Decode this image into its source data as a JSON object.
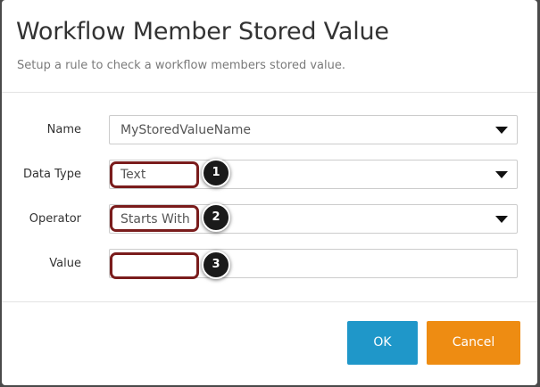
{
  "dialog": {
    "title": "Workflow Member Stored Value",
    "subtitle": "Setup a rule to check a workflow members stored value."
  },
  "form": {
    "name": {
      "label": "Name",
      "value": "MyStoredValueName"
    },
    "data_type": {
      "label": "Data Type",
      "value": "Text"
    },
    "operator": {
      "label": "Operator",
      "value": "Starts With"
    },
    "value": {
      "label": "Value",
      "value": ""
    }
  },
  "callouts": [
    "1",
    "2",
    "3"
  ],
  "buttons": {
    "ok": "OK",
    "cancel": "Cancel"
  },
  "colors": {
    "ok_button": "#1f97c9",
    "cancel_button": "#ee8c12",
    "callout_border": "#7a1c1c",
    "marker": "#1a1a1a"
  },
  "icons": {
    "dropdown": "caret-down-icon"
  }
}
